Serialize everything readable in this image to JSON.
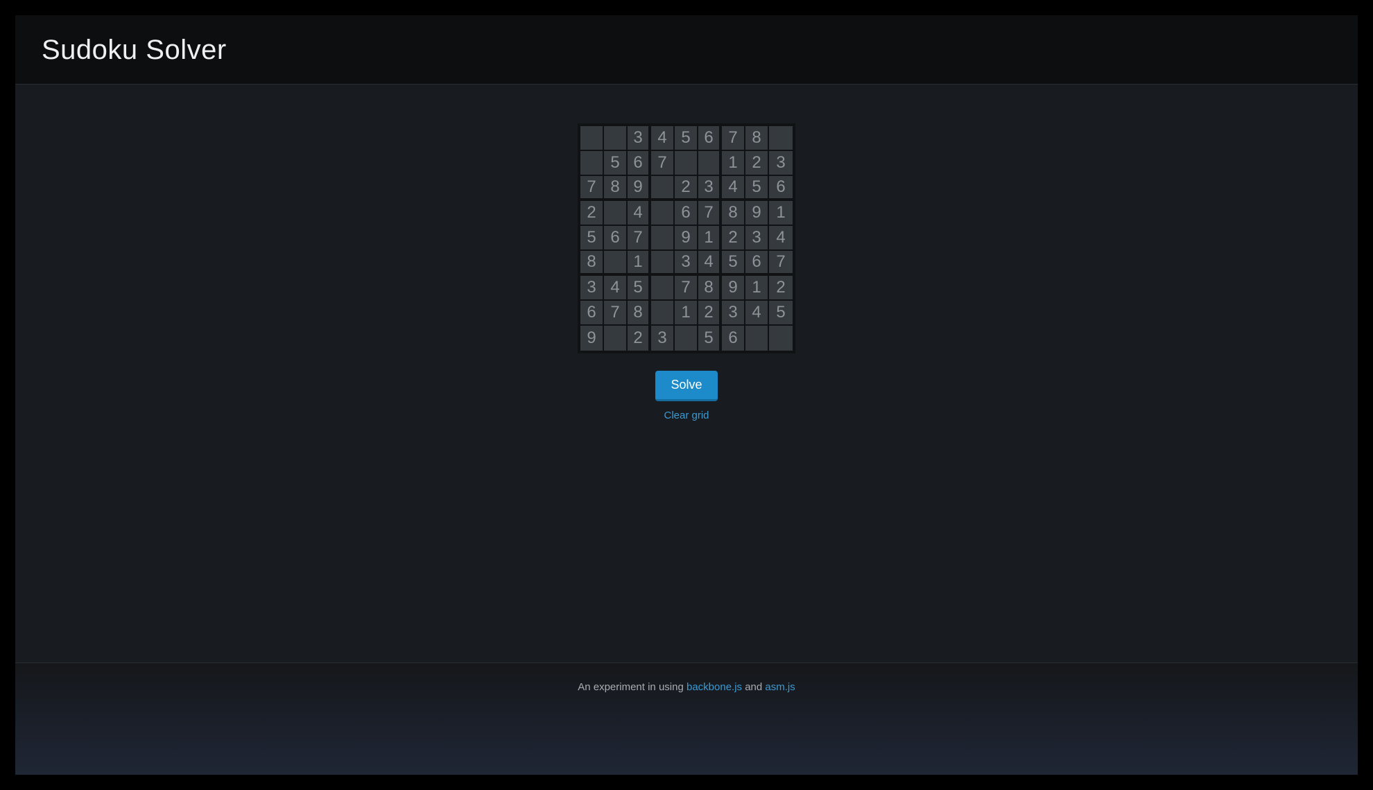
{
  "header": {
    "title": "Sudoku Solver"
  },
  "board": {
    "cells": [
      [
        "",
        "",
        "3",
        "4",
        "5",
        "6",
        "7",
        "8",
        ""
      ],
      [
        "",
        "5",
        "6",
        "7",
        "",
        "",
        "1",
        "2",
        "3"
      ],
      [
        "7",
        "8",
        "9",
        "",
        "2",
        "3",
        "4",
        "5",
        "6"
      ],
      [
        "2",
        "",
        "4",
        "",
        "6",
        "7",
        "8",
        "9",
        "1"
      ],
      [
        "5",
        "6",
        "7",
        "",
        "9",
        "1",
        "2",
        "3",
        "4"
      ],
      [
        "8",
        "",
        "1",
        "",
        "3",
        "4",
        "5",
        "6",
        "7"
      ],
      [
        "3",
        "4",
        "5",
        "",
        "7",
        "8",
        "9",
        "1",
        "2"
      ],
      [
        "6",
        "7",
        "8",
        "",
        "1",
        "2",
        "3",
        "4",
        "5"
      ],
      [
        "9",
        "",
        "2",
        "3",
        "",
        "5",
        "6",
        "",
        ""
      ]
    ]
  },
  "controls": {
    "solve_label": "Solve",
    "clear_label": "Clear grid"
  },
  "footer": {
    "prefix": "An experiment in using ",
    "link1": "backbone.js",
    "mid": " and ",
    "link2": "asm.js"
  }
}
